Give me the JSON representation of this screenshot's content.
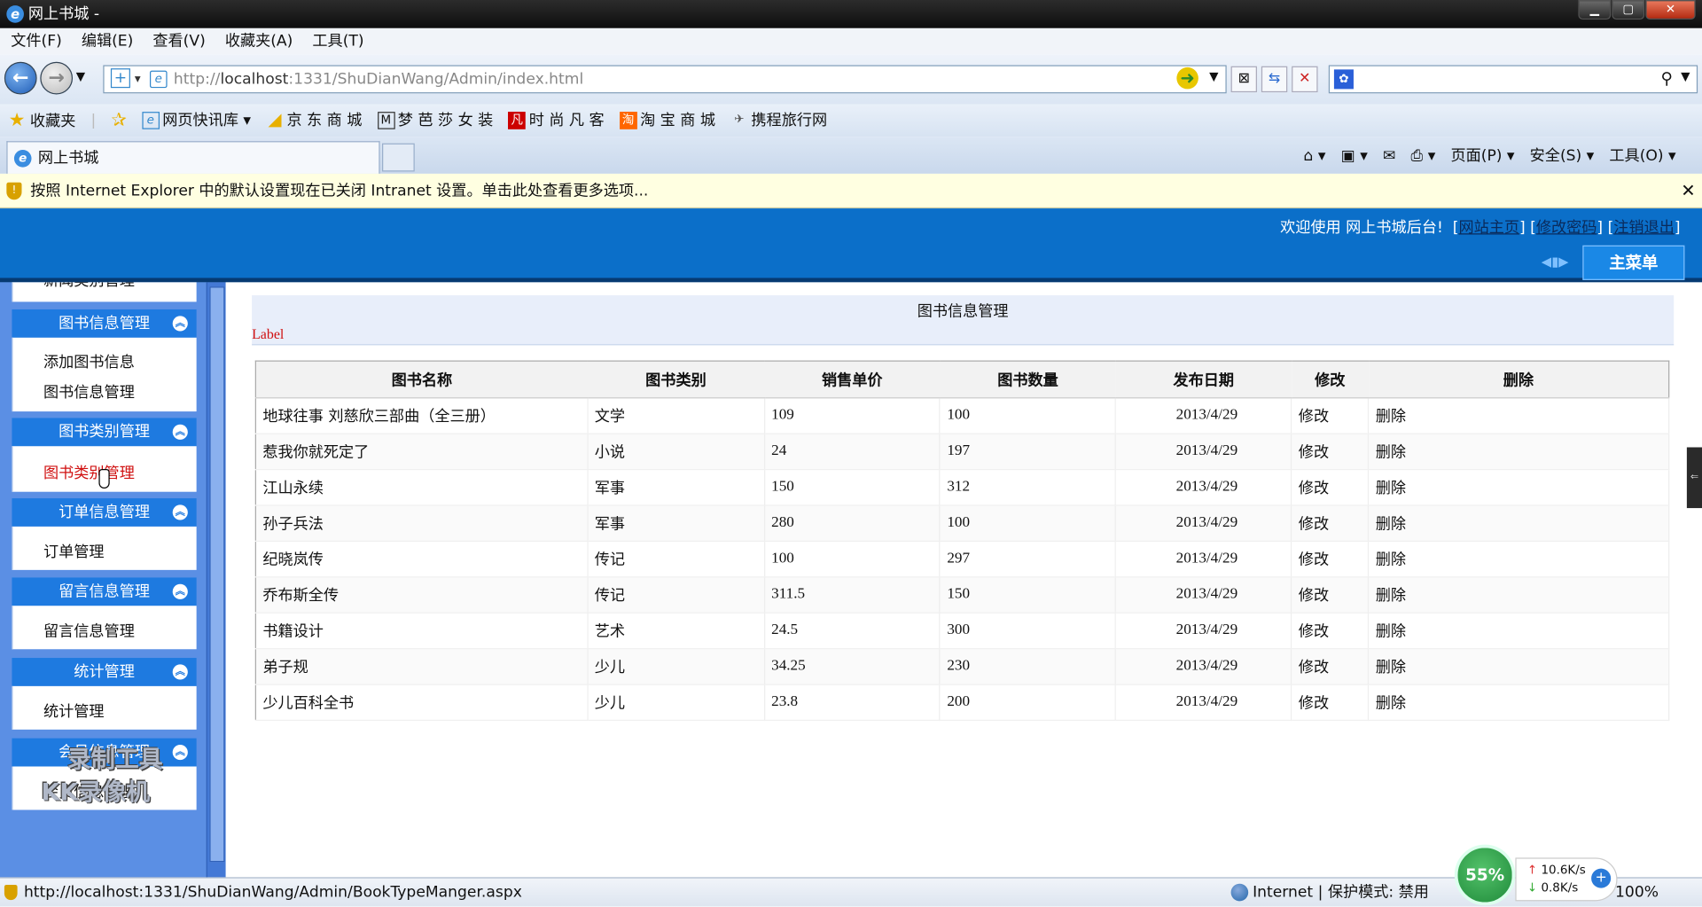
{
  "window": {
    "title": "网上书城 -"
  },
  "menubar": [
    "文件(F)",
    "编辑(E)",
    "查看(V)",
    "收藏夹(A)",
    "工具(T)"
  ],
  "address": {
    "prefix": "http://",
    "host": "localhost",
    "rest": ":1331/ShuDianWang/Admin/index.html"
  },
  "favorites": {
    "label": "收藏夹",
    "items": [
      "网页快讯库 ▾",
      "京 东 商 城",
      "梦 芭 莎 女 装",
      "时 尚 凡 客",
      "淘 宝 商 城",
      "携程旅行网"
    ]
  },
  "tab": {
    "label": "网上书城"
  },
  "commandbar": [
    "页面(P) ▾",
    "安全(S) ▾",
    "工具(O) ▾"
  ],
  "infobar": {
    "text": "按照 Internet Explorer 中的默认设置现在已关闭 Intranet 设置。单击此处查看更多选项..."
  },
  "header": {
    "welcome": "欢迎使用 网上书城后台!",
    "links": [
      "网站主页",
      "修改密码",
      "注销退出"
    ],
    "main_menu": "主菜单"
  },
  "sidebar": {
    "top_cut": "新闻类别管理",
    "groups": [
      {
        "title": "图书信息管理",
        "items": [
          "添加图书信息",
          "图书信息管理"
        ]
      },
      {
        "title": "图书类别管理",
        "items": [
          "图书类别管理"
        ]
      },
      {
        "title": "订单信息管理",
        "items": [
          "订单管理"
        ]
      },
      {
        "title": "留言信息管理",
        "items": [
          "留言信息管理"
        ]
      },
      {
        "title": "统计管理",
        "items": [
          "统计管理"
        ]
      },
      {
        "title": "会员信息管理",
        "items": [
          "会员信息管理"
        ]
      }
    ],
    "watermark_line1": "录制工具",
    "watermark_line2": "KK录像机"
  },
  "page": {
    "title": "图书信息管理",
    "label": "Label",
    "columns": [
      "图书名称",
      "图书类别",
      "销售单价",
      "图书数量",
      "发布日期",
      "修改",
      "删除"
    ],
    "rows": [
      [
        "地球往事 刘慈欣三部曲（全三册）",
        "文学",
        "109",
        "100",
        "2013/4/29",
        "修改",
        "删除"
      ],
      [
        "惹我你就死定了",
        "小说",
        "24",
        "197",
        "2013/4/29",
        "修改",
        "删除"
      ],
      [
        "江山永续",
        "军事",
        "150",
        "312",
        "2013/4/29",
        "修改",
        "删除"
      ],
      [
        "孙子兵法",
        "军事",
        "280",
        "100",
        "2013/4/29",
        "修改",
        "删除"
      ],
      [
        "纪晓岚传",
        "传记",
        "100",
        "297",
        "2013/4/29",
        "修改",
        "删除"
      ],
      [
        "乔布斯全传",
        "传记",
        "311.5",
        "150",
        "2013/4/29",
        "修改",
        "删除"
      ],
      [
        "书籍设计",
        "艺术",
        "24.5",
        "300",
        "2013/4/29",
        "修改",
        "删除"
      ],
      [
        "弟子规",
        "少儿",
        "34.25",
        "230",
        "2013/4/29",
        "修改",
        "删除"
      ],
      [
        "少儿百科全书",
        "少儿",
        "23.8",
        "200",
        "2013/4/29",
        "修改",
        "删除"
      ]
    ]
  },
  "statusbar": {
    "url": "http://localhost:1331/ShuDianWang/Admin/BookTypeManger.aspx",
    "zone": "Internet | 保护模式: 禁用",
    "zoom": "100%"
  },
  "network": {
    "percent": "55%",
    "up": "10.6K/s",
    "down": "0.8K/s"
  }
}
